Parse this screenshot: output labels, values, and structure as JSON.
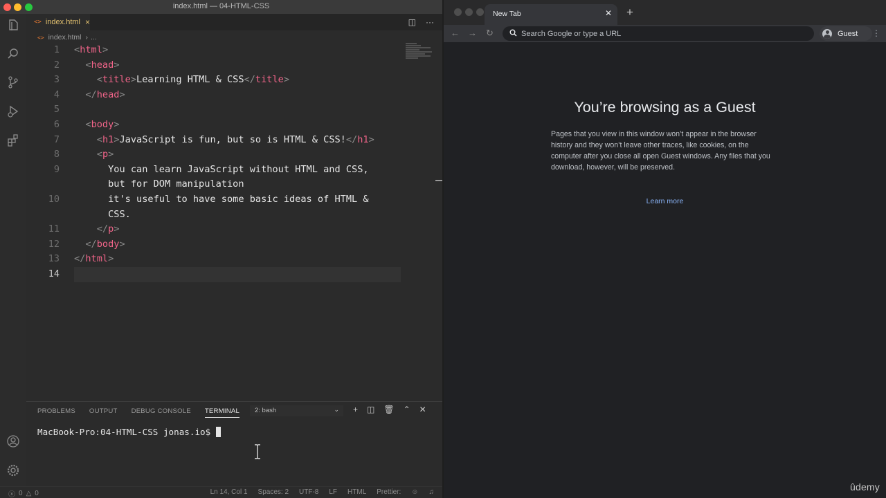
{
  "vscode": {
    "window_title": "index.html — 04-HTML-CSS",
    "colors": {
      "close": "#ff5f57",
      "minimize": "#febc2e",
      "maximize": "#28c840",
      "tag": "#f2658a",
      "tab_text": "#e3c16f"
    },
    "activity_icons": [
      "files-icon",
      "search-icon",
      "source-control-icon",
      "run-debug-icon",
      "extensions-icon",
      "accounts-icon",
      "settings-gear-icon"
    ],
    "tab": {
      "label": "index.html",
      "icon": "<>",
      "close": "×"
    },
    "breadcrumb": {
      "file": "index.html",
      "more": "..."
    },
    "code_lines": [
      {
        "num": "1",
        "parts": [
          [
            "br",
            "<"
          ],
          [
            "tag",
            "html"
          ],
          [
            "br",
            ">"
          ]
        ]
      },
      {
        "num": "2",
        "parts": [
          [
            "txt",
            "  "
          ],
          [
            "br",
            "<"
          ],
          [
            "tag",
            "head"
          ],
          [
            "br",
            ">"
          ]
        ]
      },
      {
        "num": "3",
        "parts": [
          [
            "txt",
            "    "
          ],
          [
            "br",
            "<"
          ],
          [
            "tag",
            "title"
          ],
          [
            "br",
            ">"
          ],
          [
            "txt",
            "Learning HTML & CSS"
          ],
          [
            "br",
            "</"
          ],
          [
            "tag",
            "title"
          ],
          [
            "br",
            ">"
          ]
        ]
      },
      {
        "num": "4",
        "parts": [
          [
            "txt",
            "  "
          ],
          [
            "br",
            "</"
          ],
          [
            "tag",
            "head"
          ],
          [
            "br",
            ">"
          ]
        ]
      },
      {
        "num": "5",
        "parts": []
      },
      {
        "num": "6",
        "parts": [
          [
            "txt",
            "  "
          ],
          [
            "br",
            "<"
          ],
          [
            "tag",
            "body"
          ],
          [
            "br",
            ">"
          ]
        ]
      },
      {
        "num": "7",
        "parts": [
          [
            "txt",
            "    "
          ],
          [
            "br",
            "<"
          ],
          [
            "tag",
            "h1"
          ],
          [
            "br",
            ">"
          ],
          [
            "txt",
            "JavaScript is fun, but so is HTML & CSS!"
          ],
          [
            "br",
            "</"
          ],
          [
            "tag",
            "h1"
          ],
          [
            "br",
            ">"
          ]
        ]
      },
      {
        "num": "8",
        "parts": [
          [
            "txt",
            "    "
          ],
          [
            "br",
            "<"
          ],
          [
            "tag",
            "p"
          ],
          [
            "br",
            ">"
          ]
        ]
      },
      {
        "num": "9",
        "parts": [
          [
            "txt",
            "      You can learn JavaScript without HTML and CSS,"
          ]
        ]
      },
      {
        "num": "",
        "parts": [
          [
            "txt",
            "      but for DOM manipulation"
          ]
        ]
      },
      {
        "num": "10",
        "parts": [
          [
            "txt",
            "      it's useful to have some basic ideas of HTML &"
          ]
        ]
      },
      {
        "num": "",
        "parts": [
          [
            "txt",
            "      CSS."
          ]
        ]
      },
      {
        "num": "11",
        "parts": [
          [
            "txt",
            "    "
          ],
          [
            "br",
            "</"
          ],
          [
            "tag",
            "p"
          ],
          [
            "br",
            ">"
          ]
        ]
      },
      {
        "num": "12",
        "parts": [
          [
            "txt",
            "  "
          ],
          [
            "br",
            "</"
          ],
          [
            "tag",
            "body"
          ],
          [
            "br",
            ">"
          ]
        ]
      },
      {
        "num": "13",
        "parts": [
          [
            "br",
            "</"
          ],
          [
            "tag",
            "html"
          ],
          [
            "br",
            ">"
          ]
        ]
      },
      {
        "num": "14",
        "parts": [],
        "current": true
      }
    ],
    "panel": {
      "tabs": [
        "PROBLEMS",
        "OUTPUT",
        "DEBUG CONSOLE",
        "TERMINAL"
      ],
      "active_tab": "TERMINAL",
      "terminal_select": "2: bash",
      "prompt": "MacBook-Pro:04-HTML-CSS jonas.io$"
    },
    "status": {
      "errors": "0",
      "warnings": "0",
      "position": "Ln 14, Col 1",
      "spaces": "Spaces: 2",
      "encoding": "UTF-8",
      "eol": "LF",
      "language": "HTML",
      "formatter": "Prettier:"
    }
  },
  "chrome": {
    "tab_title": "New Tab",
    "omnibox_placeholder": "Search Google or type a URL",
    "profile": "Guest",
    "guest_title": "You’re browsing as a Guest",
    "guest_description": "Pages that you view in this window won’t appear in the browser history and they won’t leave other traces, like cookies, on the computer after you close all open Guest windows. Any files that you download, however, will be preserved.",
    "learn_more": "Learn more",
    "colors": {
      "link": "#8ab4f8",
      "background": "#202124"
    }
  },
  "watermark": "ûdemy"
}
